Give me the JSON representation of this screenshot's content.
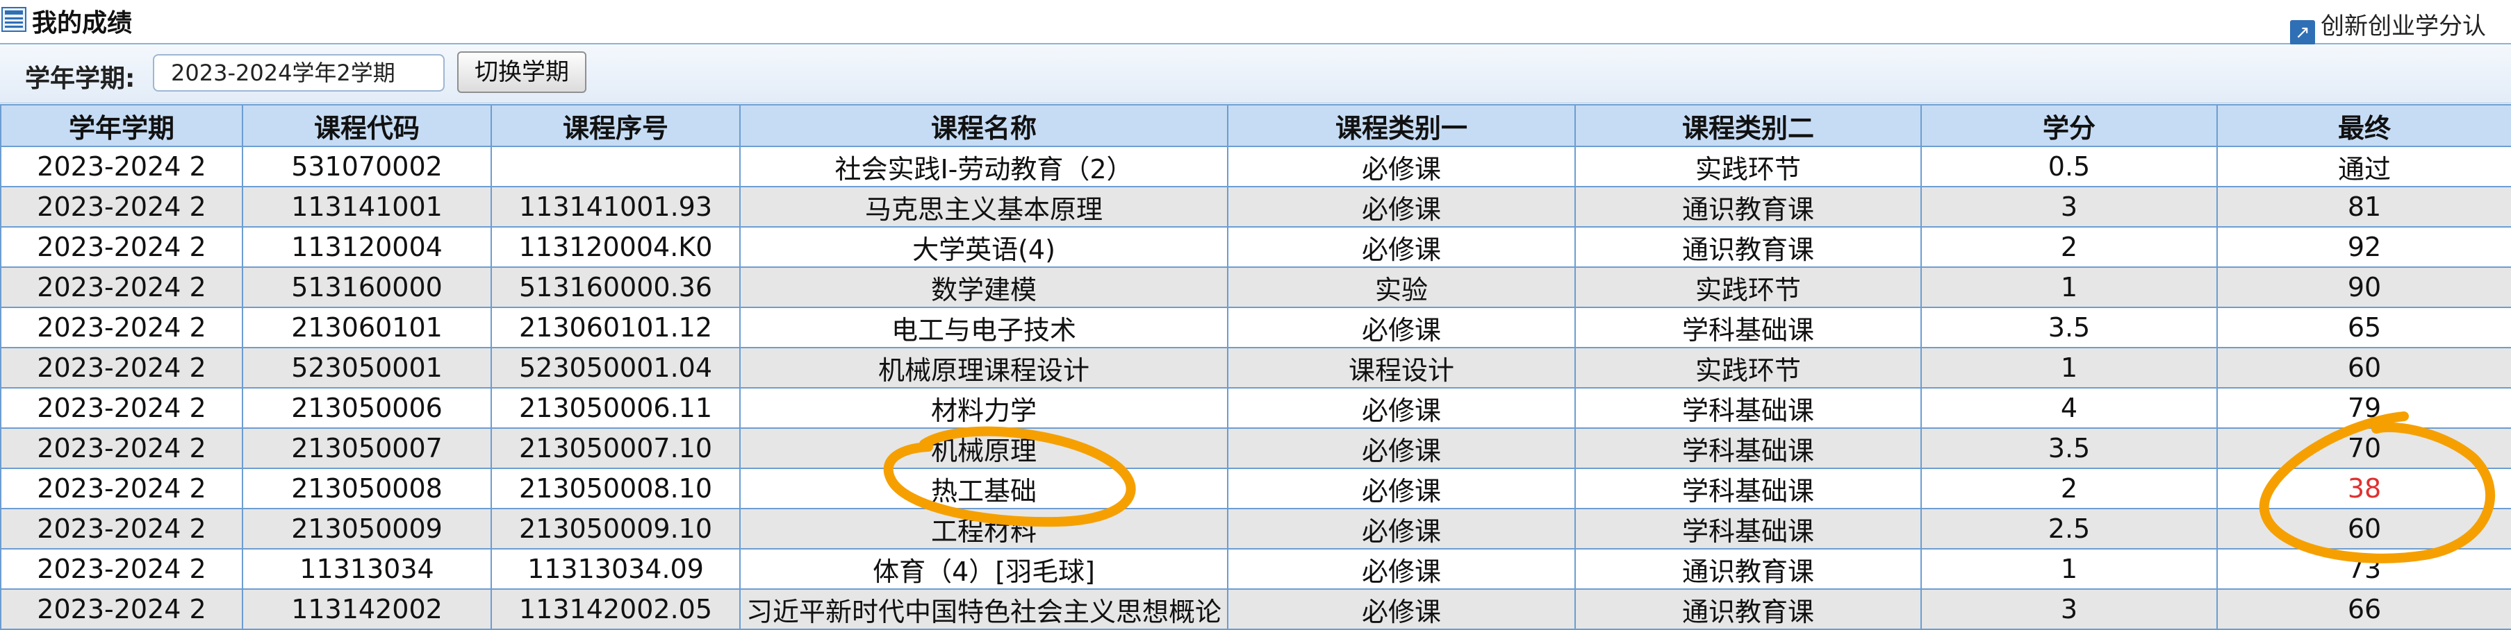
{
  "header": {
    "title": "我的成绩",
    "right_link": "创新创业学分认",
    "title_icon": "grid-icon",
    "link_icon": "external-link-icon"
  },
  "filter": {
    "label": "学年学期:",
    "term_value": "2023-2024学年2学期",
    "switch_button": "切换学期"
  },
  "table": {
    "columns": [
      "学年学期",
      "课程代码",
      "课程序号",
      "课程名称",
      "课程类别一",
      "课程类别二",
      "学分",
      "最终"
    ],
    "rows": [
      [
        "2023-2024 2",
        "531070002",
        "",
        "社会实践Ⅰ-劳动教育（2）",
        "必修课",
        "实践环节",
        "0.5",
        "通过"
      ],
      [
        "2023-2024 2",
        "113141001",
        "113141001.93",
        "马克思主义基本原理",
        "必修课",
        "通识教育课",
        "3",
        "81"
      ],
      [
        "2023-2024 2",
        "113120004",
        "113120004.K0",
        "大学英语(4)",
        "必修课",
        "通识教育课",
        "2",
        "92"
      ],
      [
        "2023-2024 2",
        "513160000",
        "513160000.36",
        "数学建模",
        "实验",
        "实践环节",
        "1",
        "90"
      ],
      [
        "2023-2024 2",
        "213060101",
        "213060101.12",
        "电工与电子技术",
        "必修课",
        "学科基础课",
        "3.5",
        "65"
      ],
      [
        "2023-2024 2",
        "523050001",
        "523050001.04",
        "机械原理课程设计",
        "课程设计",
        "实践环节",
        "1",
        "60"
      ],
      [
        "2023-2024 2",
        "213050006",
        "213050006.11",
        "材料力学",
        "必修课",
        "学科基础课",
        "4",
        "79"
      ],
      [
        "2023-2024 2",
        "213050007",
        "213050007.10",
        "机械原理",
        "必修课",
        "学科基础课",
        "3.5",
        "70"
      ],
      [
        "2023-2024 2",
        "213050008",
        "213050008.10",
        "热工基础",
        "必修课",
        "学科基础课",
        "2",
        "38"
      ],
      [
        "2023-2024 2",
        "213050009",
        "213050009.10",
        "工程材料",
        "必修课",
        "学科基础课",
        "2.5",
        "60"
      ],
      [
        "2023-2024 2",
        "11313034",
        "11313034.09",
        "体育（4）[羽毛球]",
        "必修课",
        "通识教育课",
        "1",
        "73"
      ],
      [
        "2023-2024 2",
        "113142002",
        "113142002.05",
        "习近平新时代中国特色社会主义思想概论",
        "必修课",
        "通识教育课",
        "3",
        "66"
      ]
    ],
    "failing_row_index": 8,
    "colors": {
      "header_bg": "#c6dcf4",
      "border": "#6c9dd1",
      "alt_row_bg": "#e6e6e6",
      "fail_text": "#e03030",
      "annotation_stroke": "#f5a000"
    }
  }
}
